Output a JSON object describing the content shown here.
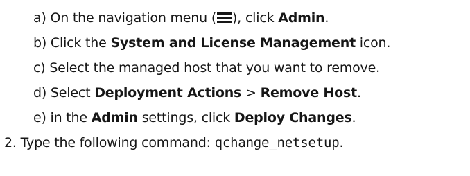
{
  "steps": [
    {
      "marker": "a)",
      "parts": [
        "On the navigation menu (",
        "), click ",
        "Admin",
        "."
      ],
      "icon": "hamburger-menu-icon"
    },
    {
      "marker": "b)",
      "parts": [
        "Click the ",
        "System and License Management",
        " icon."
      ]
    },
    {
      "marker": "c)",
      "parts": [
        "Select the managed host that you want to remove."
      ]
    },
    {
      "marker": "d)",
      "parts": [
        "Select ",
        "Deployment Actions",
        " > ",
        "Remove Host",
        "."
      ]
    },
    {
      "marker": "e)",
      "parts": [
        "in the ",
        "Admin",
        " settings, click ",
        "Deploy Changes",
        "."
      ]
    }
  ],
  "numbered_step": {
    "number": "2.",
    "text": "Type the following command: ",
    "command": "qchange_netsetup",
    "end": "."
  }
}
